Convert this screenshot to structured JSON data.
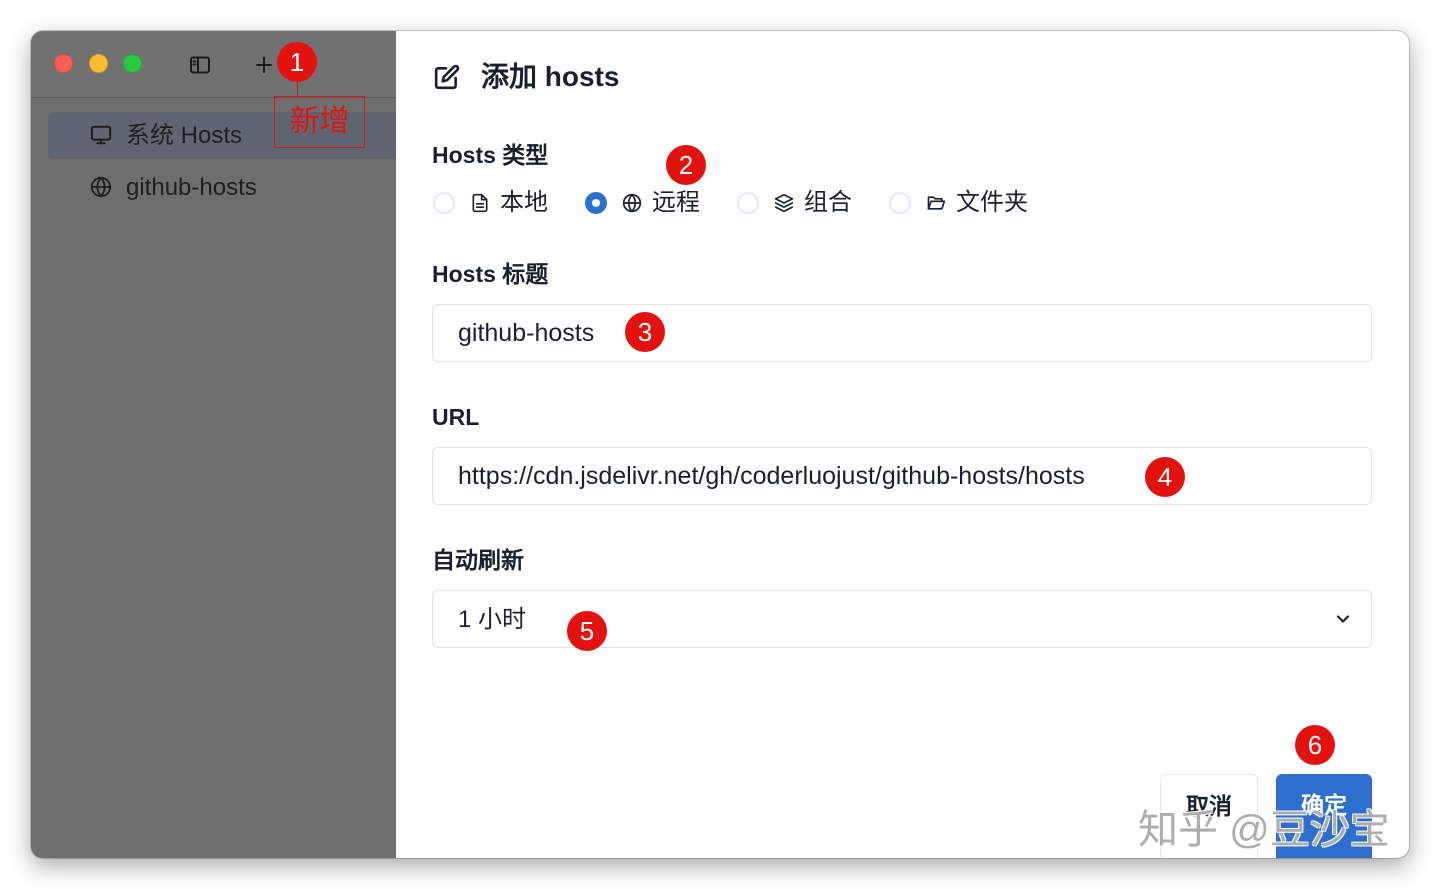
{
  "colors": {
    "accent": "#2c6fcf",
    "annotation_red": "#e3120f",
    "traffic_close": "#ff5f57",
    "traffic_minimize": "#febc2e",
    "traffic_zoom": "#28c840"
  },
  "toolbar": {
    "icons": [
      "sidebar-icon",
      "plus-icon"
    ]
  },
  "sidebar": {
    "items": [
      {
        "label": "系统 Hosts",
        "icon": "monitor-icon",
        "selected": true
      },
      {
        "label": "github-hosts",
        "icon": "globe-icon",
        "selected": false
      }
    ]
  },
  "dialog": {
    "title": "添加 hosts",
    "title_icon": "edit-icon",
    "type_field": {
      "label": "Hosts 类型",
      "options": [
        {
          "label": "本地",
          "icon": "file-icon",
          "checked": false
        },
        {
          "label": "远程",
          "icon": "globe-icon",
          "checked": true
        },
        {
          "label": "组合",
          "icon": "layers-icon",
          "checked": false
        },
        {
          "label": "文件夹",
          "icon": "folder-icon",
          "checked": false
        }
      ]
    },
    "title_field": {
      "label": "Hosts 标题",
      "value": "github-hosts"
    },
    "url_field": {
      "label": "URL",
      "value": "https://cdn.jsdelivr.net/gh/coderluojust/github-hosts/hosts"
    },
    "refresh_field": {
      "label": "自动刷新",
      "value": "1 小时",
      "icon": "chevron-down-icon"
    },
    "cancel_label": "取消",
    "confirm_label": "确定"
  },
  "annotations": {
    "markers": [
      "1",
      "2",
      "3",
      "4",
      "5",
      "6"
    ],
    "add_box_label": "新增"
  },
  "watermark": "知乎 @豆沙宝"
}
